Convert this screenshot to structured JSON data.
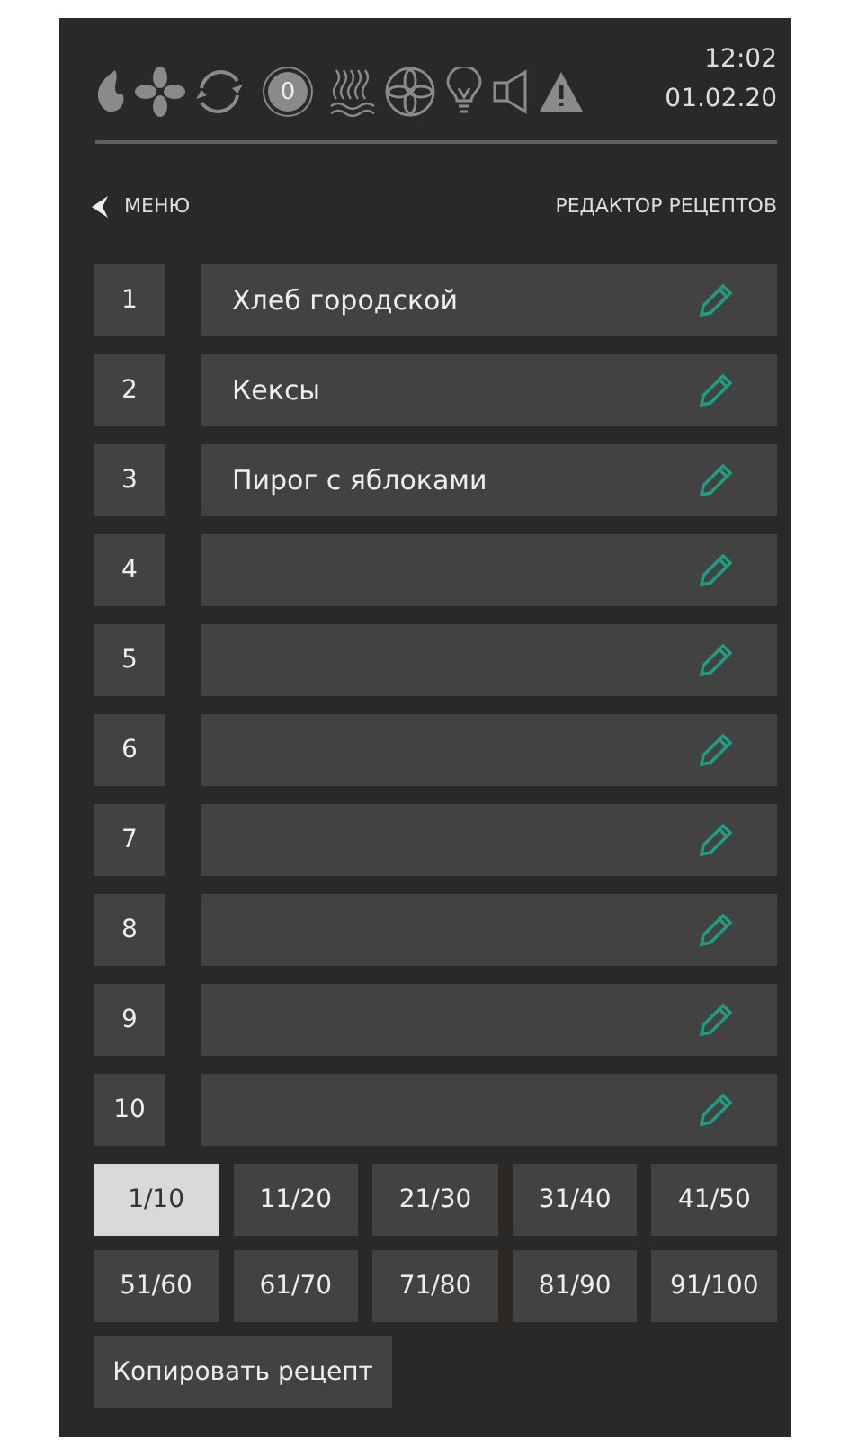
{
  "status_bar": {
    "counter": "0",
    "time": "12:02",
    "date": "01.02.20"
  },
  "header": {
    "back": "МЕНЮ",
    "title": "РЕДАКТОР РЕЦЕПТОВ"
  },
  "recipes": [
    {
      "number": "1",
      "name": "Хлеб городской"
    },
    {
      "number": "2",
      "name": "Кексы"
    },
    {
      "number": "3",
      "name": "Пирог с яблоками"
    },
    {
      "number": "4"
    },
    {
      "number": "5"
    },
    {
      "number": "6"
    },
    {
      "number": "7"
    },
    {
      "number": "8"
    },
    {
      "number": "9"
    },
    {
      "number": "10"
    }
  ],
  "pages": [
    {
      "label": "1/10",
      "selected": true
    },
    {
      "label": "11/20",
      "selected": false
    },
    {
      "label": "21/30",
      "selected": false
    },
    {
      "label": "31/40",
      "selected": false
    },
    {
      "label": "41/50",
      "selected": false
    },
    {
      "label": "51/60",
      "selected": false
    },
    {
      "label": "61/70",
      "selected": false
    },
    {
      "label": "71/80",
      "selected": false
    },
    {
      "label": "81/90",
      "selected": false
    },
    {
      "label": "91/100",
      "selected": false
    }
  ],
  "copy_button": "Копировать рецепт"
}
